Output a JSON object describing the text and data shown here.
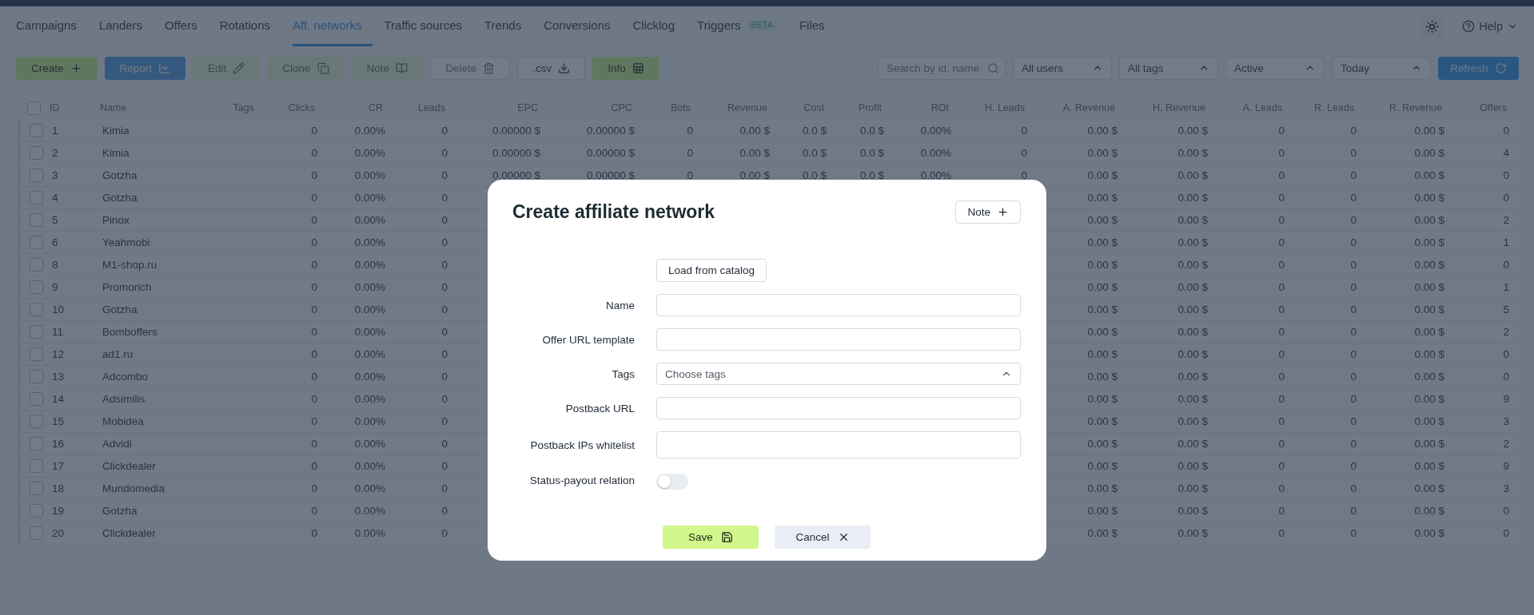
{
  "nav": {
    "tabs": [
      {
        "label": "Campaigns",
        "selected": false
      },
      {
        "label": "Landers",
        "selected": false
      },
      {
        "label": "Offers",
        "selected": false
      },
      {
        "label": "Rotations",
        "selected": false
      },
      {
        "label": "Aff. networks",
        "selected": true
      },
      {
        "label": "Traffic sources",
        "selected": false
      },
      {
        "label": "Trends",
        "selected": false
      },
      {
        "label": "Conversions",
        "selected": false
      },
      {
        "label": "Clicklog",
        "selected": false
      },
      {
        "label": "Triggers",
        "selected": false,
        "badge": "BETA"
      },
      {
        "label": "Files",
        "selected": false
      }
    ],
    "help": "Help"
  },
  "toolbar": {
    "buttons": [
      {
        "label": "Create",
        "kind": "green",
        "disabled": false
      },
      {
        "label": "Report",
        "kind": "blue",
        "disabled": false
      },
      {
        "label": "Edit",
        "kind": "green",
        "disabled": true
      },
      {
        "label": "Clone",
        "kind": "green",
        "disabled": true
      },
      {
        "label": "Note",
        "kind": "green",
        "disabled": true
      },
      {
        "label": "Delete",
        "kind": "outline",
        "disabled": true
      },
      {
        "label": ".csv",
        "kind": "outline",
        "disabled": false
      },
      {
        "label": "Info",
        "kind": "green",
        "disabled": false
      }
    ],
    "search": {
      "placeholder": "Search by id, name"
    },
    "dropdowns": [
      "All users",
      "All tags",
      "Active",
      "Today"
    ],
    "refresh": "Refresh"
  },
  "table": {
    "header_checked": false,
    "columns": [
      "ID",
      "Name",
      "Tags",
      "Clicks",
      "CR",
      "Leads",
      "EPC",
      "CPC",
      "Bots",
      "Revenue",
      "Cost",
      "Profit",
      "ROI",
      "H. Leads",
      "A. Revenue",
      "H. Revenue",
      "A. Leads",
      "R. Leads",
      "R. Revenue",
      "Offers"
    ],
    "rows": [
      {
        "checked": false,
        "cells": [
          "1",
          "Kimia",
          null,
          "0",
          "0.00%",
          "0",
          "0.00000 $",
          "0.00000 $",
          "0",
          "0.00 $",
          "0.0 $",
          "0.0 $",
          "0.00%",
          "0",
          "0.00 $",
          "0.00 $",
          "0",
          "0",
          "0.00 $",
          "0"
        ]
      },
      {
        "checked": false,
        "cells": [
          "2",
          "Kimia",
          null,
          "0",
          "0.00%",
          "0",
          "0.00000 $",
          "0.00000 $",
          "0",
          "0.00 $",
          "0.0 $",
          "0.0 $",
          "0.00%",
          "0",
          "0.00 $",
          "0.00 $",
          "0",
          "0",
          "0.00 $",
          "4"
        ]
      },
      {
        "checked": false,
        "cells": [
          "3",
          "Gotzha",
          null,
          "0",
          "0.00%",
          "0",
          "0.00000 $",
          "0.00000 $",
          "0",
          "0.00 $",
          "0.0 $",
          "0.0 $",
          "0.00%",
          "0",
          "0.00 $",
          "0.00 $",
          "0",
          "0",
          "0.00 $",
          "0"
        ]
      },
      {
        "checked": false,
        "cells": [
          "4",
          "Gotzha",
          null,
          "0",
          "0.00%",
          "0",
          null,
          null,
          null,
          null,
          null,
          null,
          null,
          null,
          "0.00 $",
          "0.00 $",
          "0",
          "0",
          "0.00 $",
          "0"
        ]
      },
      {
        "checked": false,
        "cells": [
          "5",
          "Pinox",
          null,
          "0",
          "0.00%",
          "0",
          null,
          null,
          null,
          null,
          null,
          null,
          null,
          null,
          "0.00 $",
          "0.00 $",
          "0",
          "0",
          "0.00 $",
          "2"
        ]
      },
      {
        "checked": false,
        "cells": [
          "6",
          "Yeahmobi",
          null,
          "0",
          "0.00%",
          "0",
          null,
          null,
          null,
          null,
          null,
          null,
          null,
          null,
          "0.00 $",
          "0.00 $",
          "0",
          "0",
          "0.00 $",
          "1"
        ]
      },
      {
        "checked": false,
        "cells": [
          "8",
          "M1-shop.ru",
          null,
          "0",
          "0.00%",
          "0",
          null,
          null,
          null,
          null,
          null,
          null,
          null,
          null,
          "0.00 $",
          "0.00 $",
          "0",
          "0",
          "0.00 $",
          "0"
        ]
      },
      {
        "checked": false,
        "cells": [
          "9",
          "Promorich",
          null,
          "0",
          "0.00%",
          "0",
          null,
          null,
          null,
          null,
          null,
          null,
          null,
          null,
          "0.00 $",
          "0.00 $",
          "0",
          "0",
          "0.00 $",
          "1"
        ]
      },
      {
        "checked": false,
        "cells": [
          "10",
          "Gotzha",
          null,
          "0",
          "0.00%",
          "0",
          null,
          null,
          null,
          null,
          null,
          null,
          null,
          null,
          "0.00 $",
          "0.00 $",
          "0",
          "0",
          "0.00 $",
          "5"
        ]
      },
      {
        "checked": false,
        "cells": [
          "11",
          "Bomboffers",
          null,
          "0",
          "0.00%",
          "0",
          null,
          null,
          null,
          null,
          null,
          null,
          null,
          null,
          "0.00 $",
          "0.00 $",
          "0",
          "0",
          "0.00 $",
          "2"
        ]
      },
      {
        "checked": false,
        "cells": [
          "12",
          "ad1.ru",
          null,
          "0",
          "0.00%",
          "0",
          null,
          null,
          null,
          null,
          null,
          null,
          null,
          null,
          "0.00 $",
          "0.00 $",
          "0",
          "0",
          "0.00 $",
          "0"
        ]
      },
      {
        "checked": false,
        "cells": [
          "13",
          "Adcombo",
          null,
          "0",
          "0.00%",
          "0",
          null,
          null,
          null,
          null,
          null,
          null,
          null,
          null,
          "0.00 $",
          "0.00 $",
          "0",
          "0",
          "0.00 $",
          "0"
        ]
      },
      {
        "checked": false,
        "cells": [
          "14",
          "Adsimilis",
          null,
          "0",
          "0.00%",
          "0",
          null,
          null,
          null,
          null,
          null,
          null,
          null,
          null,
          "0.00 $",
          "0.00 $",
          "0",
          "0",
          "0.00 $",
          "9"
        ]
      },
      {
        "checked": false,
        "cells": [
          "15",
          "Mobidea",
          null,
          "0",
          "0.00%",
          "0",
          null,
          null,
          null,
          null,
          null,
          null,
          null,
          null,
          "0.00 $",
          "0.00 $",
          "0",
          "0",
          "0.00 $",
          "3"
        ]
      },
      {
        "checked": false,
        "cells": [
          "16",
          "Advidi",
          null,
          "0",
          "0.00%",
          "0",
          null,
          null,
          null,
          null,
          null,
          null,
          null,
          null,
          "0.00 $",
          "0.00 $",
          "0",
          "0",
          "0.00 $",
          "2"
        ]
      },
      {
        "checked": false,
        "cells": [
          "17",
          "Clickdealer",
          null,
          "0",
          "0.00%",
          "0",
          null,
          null,
          null,
          null,
          null,
          null,
          null,
          null,
          "0.00 $",
          "0.00 $",
          "0",
          "0",
          "0.00 $",
          "9"
        ]
      },
      {
        "checked": false,
        "cells": [
          "18",
          "Mundomedia",
          null,
          "0",
          "0.00%",
          "0",
          null,
          null,
          null,
          null,
          null,
          null,
          null,
          null,
          "0.00 $",
          "0.00 $",
          "0",
          "0",
          "0.00 $",
          "3"
        ]
      },
      {
        "checked": false,
        "cells": [
          "19",
          "Gotzha",
          null,
          "0",
          "0.00%",
          "0",
          null,
          null,
          null,
          null,
          null,
          null,
          null,
          null,
          "0.00 $",
          "0.00 $",
          "0",
          "0",
          "0.00 $",
          "0"
        ]
      },
      {
        "checked": false,
        "cells": [
          "20",
          "Clickdealer",
          null,
          "0",
          "0.00%",
          "0",
          null,
          null,
          null,
          null,
          null,
          null,
          null,
          null,
          "0.00 $",
          "0.00 $",
          "0",
          "0",
          "0.00 $",
          "0"
        ]
      }
    ]
  },
  "modal": {
    "title": "Create affiliate network",
    "note_button": "Note",
    "catalog_button": "Load from catalog",
    "fields": [
      {
        "label": "Name",
        "kind": "text"
      },
      {
        "label": "Offer URL template",
        "kind": "text"
      },
      {
        "label": "Tags",
        "kind": "select",
        "placeholder": "Choose tags"
      },
      {
        "label": "Postback URL",
        "kind": "text"
      },
      {
        "label": "Postback IPs whitelist",
        "kind": "textarea"
      },
      {
        "label": "Status-payout relation",
        "kind": "toggle",
        "on": false
      }
    ],
    "save": "Save",
    "cancel": "Cancel"
  }
}
